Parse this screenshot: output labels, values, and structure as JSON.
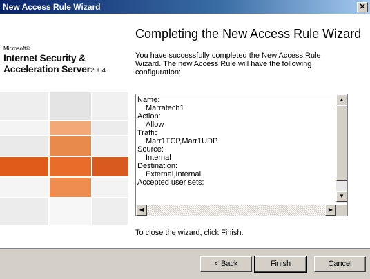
{
  "window": {
    "title": "New Access Rule Wizard",
    "close_glyph": "✕"
  },
  "branding": {
    "company": "Microsoft®",
    "product_line1": "Internet Security &",
    "product_line2": "Acceleration Server",
    "product_year": "2004"
  },
  "colors": {
    "title_bar_start": "#0a246a",
    "orange_dark": "#e05a1a",
    "orange_light": "#f2a877",
    "gray_tile": "#e6e6e6",
    "button_face": "#d4d0c8"
  },
  "main": {
    "heading": "Completing the New Access Rule Wizard",
    "intro": "You have successfully completed the New Access Rule Wizard. The new Access Rule will have the following configuration:",
    "summary_items": [
      {
        "text": "Name:",
        "indent": false
      },
      {
        "text": "Marratech1",
        "indent": true
      },
      {
        "text": "Action:",
        "indent": false
      },
      {
        "text": "Allow",
        "indent": true
      },
      {
        "text": "Traffic:",
        "indent": false
      },
      {
        "text": "Marr1TCP,Marr1UDP",
        "indent": true
      },
      {
        "text": "Source:",
        "indent": false
      },
      {
        "text": "Internal",
        "indent": true
      },
      {
        "text": "Destination:",
        "indent": false
      },
      {
        "text": "External,Internal",
        "indent": true
      },
      {
        "text": "Accepted user sets:",
        "indent": false
      }
    ],
    "close_instruction": "To close the wizard, click Finish."
  },
  "buttons": {
    "back": "< Back",
    "finish": "Finish",
    "cancel": "Cancel"
  },
  "icons": {
    "scroll_up": "▲",
    "scroll_down": "▼",
    "scroll_left": "◀",
    "scroll_right": "▶"
  }
}
